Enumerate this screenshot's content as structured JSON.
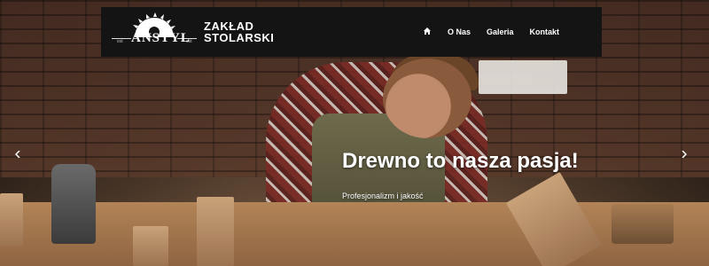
{
  "logo": {
    "text": "ANSTYL",
    "est_left": "est",
    "est_right": "est",
    "icon": "saw-blade-icon"
  },
  "brand": {
    "line1": "ZAKŁAD",
    "line2": "STOLARSKI"
  },
  "nav": {
    "home_icon": "home-icon",
    "items": [
      {
        "label": "O Nas"
      },
      {
        "label": "Galeria"
      },
      {
        "label": "Kontakt"
      }
    ]
  },
  "hero": {
    "headline": "Drewno to nasza pasja!",
    "subtitle": "Profesjonalizm i jakość"
  },
  "carousel": {
    "prev_icon": "chevron-left-icon",
    "next_icon": "chevron-right-icon"
  },
  "colors": {
    "navbar_bg": "#141414",
    "text": "#ffffff"
  }
}
